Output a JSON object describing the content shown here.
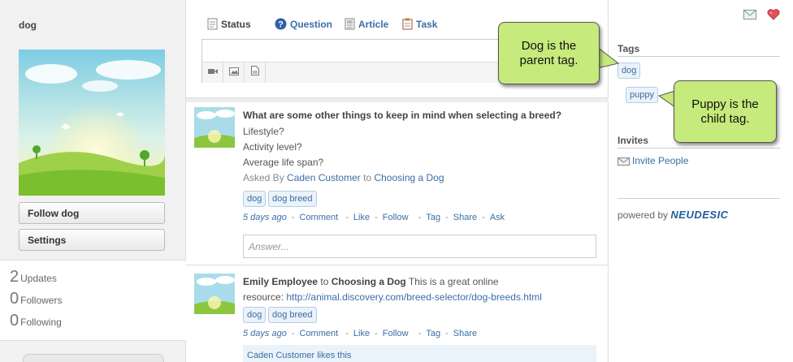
{
  "left": {
    "page_name": "dog",
    "follow_button": "Follow dog",
    "settings_button": "Settings",
    "stats": [
      {
        "num": "2",
        "label": "Updates"
      },
      {
        "num": "0",
        "label": "Followers"
      },
      {
        "num": "0",
        "label": "Following"
      }
    ]
  },
  "composer": {
    "tabs": [
      "Status",
      "Question",
      "Article",
      "Task"
    ]
  },
  "post1": {
    "title": "What are some other things to keep in mind when selecting a breed?",
    "lines": [
      "Lifestyle?",
      "Activity level?",
      "Average life span?"
    ],
    "asked_by": "Asked By",
    "author": "Caden Customer",
    "to": "to",
    "group": "Choosing a Dog",
    "tags": [
      "dog",
      "dog breed"
    ],
    "time": "5 days ago",
    "actions": [
      "Comment",
      "Like",
      "Follow",
      "Tag",
      "Share",
      "Ask"
    ],
    "answer_placeholder": "Answer..."
  },
  "post2": {
    "author": "Emily Employee",
    "to": "to",
    "group": "Choosing a Dog",
    "text1": "This is a great online",
    "text2": "resource:",
    "url": "http://animal.discovery.com/breed-selector/dog-breeds.html",
    "tags": [
      "dog",
      "dog breed"
    ],
    "time": "5 days ago",
    "actions": [
      "Comment",
      "Like",
      "Follow",
      "Tag",
      "Share"
    ],
    "likes": "Caden Customer likes this"
  },
  "right": {
    "tags_heading": "Tags",
    "tag_parent": "dog",
    "tag_child": "puppy",
    "invites_heading": "Invites",
    "invite_link": "Invite People",
    "powered_by": "powered by",
    "brand": "NEUDESIC"
  },
  "callouts": {
    "parent_line1": "Dog is the",
    "parent_line2": "parent tag.",
    "child_line1": "Puppy is the",
    "child_line2": "child tag."
  },
  "colors": {
    "link": "#3a6ea5",
    "callout_fill": "#c6ea7b",
    "tag_chip_bg": "#eaf2fa"
  }
}
